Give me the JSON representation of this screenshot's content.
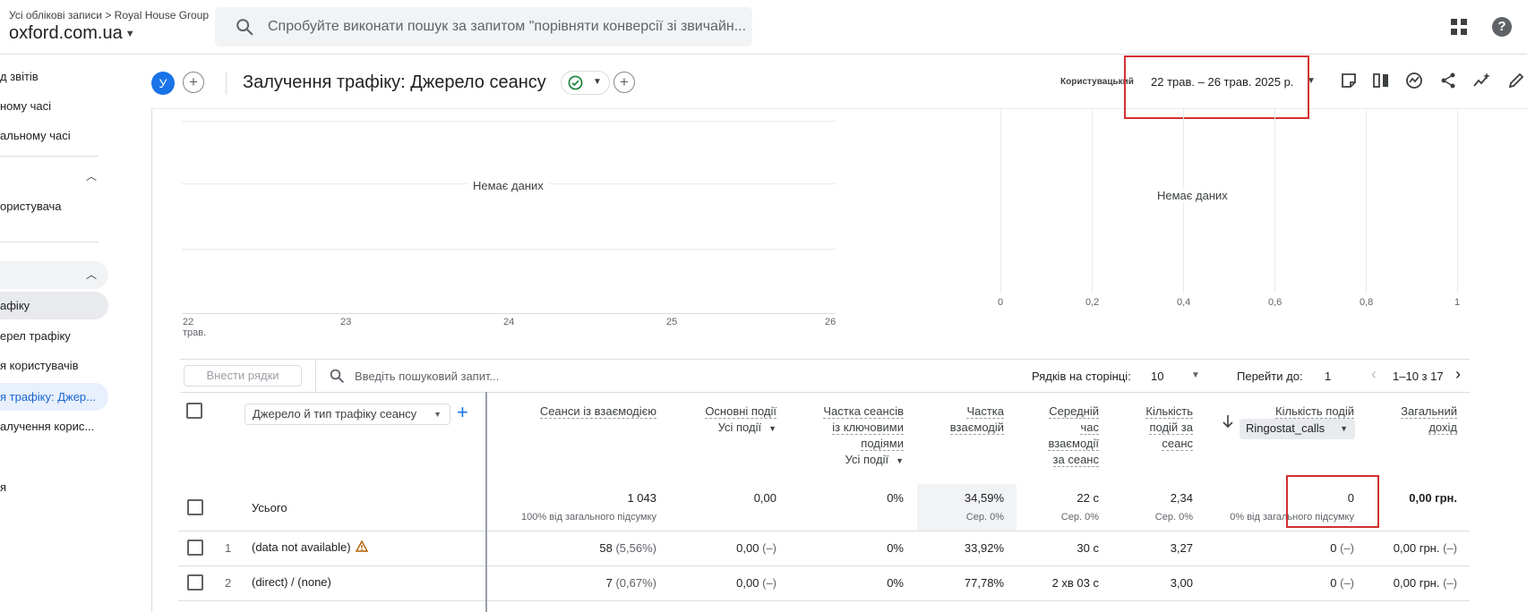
{
  "header": {
    "breadcrumb": "Усі облікові записи > Royal House Group",
    "property": "oxford.com.ua",
    "search_placeholder": "Спробуйте виконати пошук за запитом \"порівняти конверсії зі звичайн..."
  },
  "sidebar": {
    "items": [
      {
        "label": "д звітів"
      },
      {
        "label": "ному часі"
      },
      {
        "label": "альному часі"
      },
      {
        "label": "ористувача"
      },
      {
        "label": "афіку"
      },
      {
        "label": "ерел трафіку"
      },
      {
        "label": "я користувачів"
      },
      {
        "label": "я трафіку: Джер..."
      },
      {
        "label": "алучення корис..."
      },
      {
        "label": "я"
      }
    ]
  },
  "report": {
    "avatar_letter": "У",
    "title": "Залучення трафіку: Джерело сеансу",
    "date_label": "Користувацький",
    "date_range": "22 трав. – 26 трав. 2025 р."
  },
  "line_chart": {
    "no_data": "Немає даних",
    "x_ticks": [
      "22",
      "23",
      "24",
      "25",
      "26"
    ],
    "x_month": "трав."
  },
  "bar_chart": {
    "no_data": "Немає даних",
    "x_ticks": [
      "0",
      "0,2",
      "0,4",
      "0,6",
      "0,8",
      "1"
    ]
  },
  "table_toolbar": {
    "add_rows": "Внести рядки",
    "search_placeholder": "Введіть пошуковий запит...",
    "rows_per_page_label": "Рядків на сторінці:",
    "rows_per_page": "10",
    "goto_label": "Перейти до:",
    "goto_value": "1",
    "pagination": "1–10 з 17"
  },
  "table": {
    "dimension": "Джерело й тип трафіку сеансу",
    "columns": {
      "engaged_sessions": "Сеанси із взаємодією",
      "key_events": "Основні події",
      "key_events_sel": "Усі події",
      "session_rate_l1": "Частка сеансів",
      "session_rate_l2": "із ключовими",
      "session_rate_l3": "подіями",
      "session_rate_sel": "Усі події",
      "engagement_l1": "Частка",
      "engagement_l2": "взаємодій",
      "avg_time_l1": "Середній",
      "avg_time_l2": "час",
      "avg_time_l3": "взаємодії",
      "avg_time_l4": "за сеанс",
      "events_per_l1": "Кількість",
      "events_per_l2": "подій за",
      "events_per_l3": "сеанс",
      "event_count": "Кількість подій",
      "event_count_sel": "Ringostat_calls",
      "revenue_l1": "Загальний",
      "revenue_l2": "дохід"
    },
    "totals": {
      "label": "Усього",
      "engaged_sessions": "1 043",
      "engaged_sessions_sub": "100% від загального підсумку",
      "key_events": "0,00",
      "session_rate": "0%",
      "engagement": "34,59%",
      "engagement_sub": "Сер. 0%",
      "avg_time": "22 с",
      "avg_time_sub": "Сер. 0%",
      "events_per": "2,34",
      "events_per_sub": "Сер. 0%",
      "event_count": "0",
      "event_count_sub": "0% від загального підсумку",
      "revenue": "0,00 грн."
    },
    "rows": [
      {
        "index": "1",
        "name": "(data not available)",
        "engaged": "58",
        "engaged_pct": "(5,56%)",
        "key_events": "0,00",
        "key_events_delta": "(–)",
        "session_rate": "0%",
        "engagement": "33,92%",
        "avg_time": "30 с",
        "events_per": "3,27",
        "event_count": "0",
        "event_count_delta": "(–)",
        "revenue": "0,00 грн.",
        "revenue_delta": "(–)"
      },
      {
        "index": "2",
        "name": "(direct) / (none)",
        "engaged": "7",
        "engaged_pct": "(0,67%)",
        "key_events": "0,00",
        "key_events_delta": "(–)",
        "session_rate": "0%",
        "engagement": "77,78%",
        "avg_time": "2 хв 03 с",
        "events_per": "3,00",
        "event_count": "0",
        "event_count_delta": "(–)",
        "revenue": "0,00 грн.",
        "revenue_delta": "(–)"
      }
    ]
  }
}
